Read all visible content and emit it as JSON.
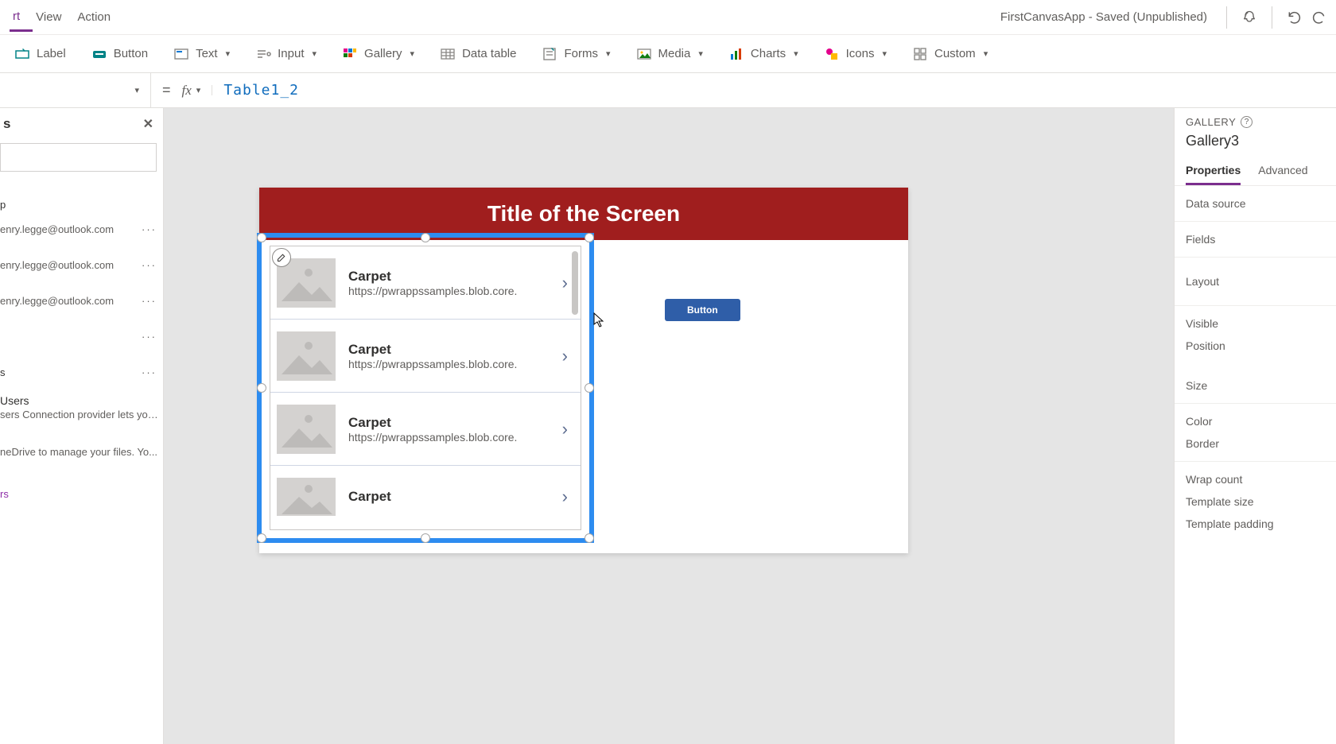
{
  "header": {
    "menu": [
      "rt",
      "View",
      "Action"
    ],
    "active_index": 0,
    "app_status": "FirstCanvasApp - Saved (Unpublished)"
  },
  "ribbon": [
    {
      "icon": "label",
      "label": "Label",
      "dd": false
    },
    {
      "icon": "button",
      "label": "Button",
      "dd": false
    },
    {
      "icon": "text",
      "label": "Text",
      "dd": true
    },
    {
      "icon": "input",
      "label": "Input",
      "dd": true
    },
    {
      "icon": "gallery",
      "label": "Gallery",
      "dd": true
    },
    {
      "icon": "datatable",
      "label": "Data table",
      "dd": false
    },
    {
      "icon": "forms",
      "label": "Forms",
      "dd": true
    },
    {
      "icon": "media",
      "label": "Media",
      "dd": true
    },
    {
      "icon": "charts",
      "label": "Charts",
      "dd": true
    },
    {
      "icon": "icons",
      "label": "Icons",
      "dd": true
    },
    {
      "icon": "custom",
      "label": "Custom",
      "dd": true
    }
  ],
  "formula": {
    "equals": "=",
    "fx": "fx",
    "value": "Table1_2"
  },
  "leftpane": {
    "title": "s",
    "items": [
      {
        "text": "p"
      },
      {
        "text": "enry.legge@outlook.com"
      },
      {
        "text": "enry.legge@outlook.com"
      },
      {
        "text": "enry.legge@outlook.com"
      },
      {
        "text": ""
      },
      {
        "text": "s"
      }
    ],
    "group_title": "Users",
    "group_desc": "sers Connection provider lets you ...",
    "group2_desc": "neDrive to manage your files. Yo...",
    "link": "rs"
  },
  "canvas": {
    "screen_title": "Title of the Screen",
    "button_label": "Button",
    "gallery_items": [
      {
        "title": "Carpet",
        "sub": "https://pwrappssamples.blob.core."
      },
      {
        "title": "Carpet",
        "sub": "https://pwrappssamples.blob.core."
      },
      {
        "title": "Carpet",
        "sub": "https://pwrappssamples.blob.core."
      },
      {
        "title": "Carpet",
        "sub": ""
      }
    ]
  },
  "rightpane": {
    "section": "GALLERY",
    "control_name": "Gallery3",
    "tabs": [
      "Properties",
      "Advanced"
    ],
    "active_tab": 0,
    "rows": [
      "Data source",
      "Fields",
      "Layout",
      "Visible",
      "Position",
      "Size",
      "Color",
      "Border",
      "Wrap count",
      "Template size",
      "Template padding"
    ]
  }
}
